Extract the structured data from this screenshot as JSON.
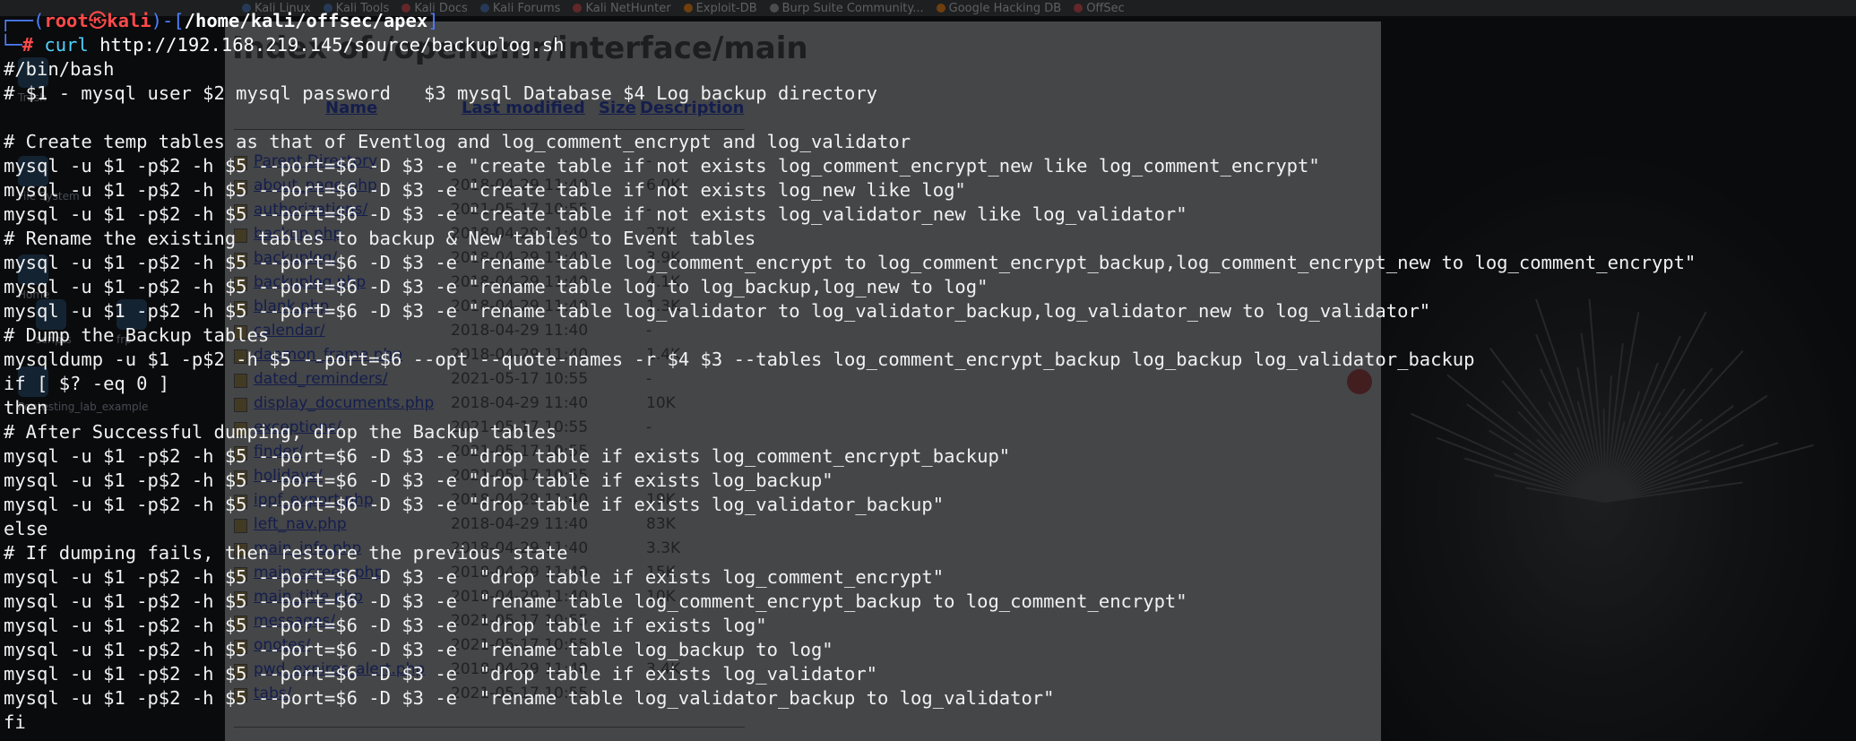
{
  "browser_bookmarks": [
    {
      "label": "Kali Linux",
      "icon": "kali-dragon-icon",
      "color": "#3a5a8a"
    },
    {
      "label": "Kali Tools",
      "icon": "kali-dragon-icon",
      "color": "#3a5a8a"
    },
    {
      "label": "Kali Docs",
      "icon": "kali-docs-icon",
      "color": "#a33a3a"
    },
    {
      "label": "Kali Forums",
      "icon": "kali-dragon-icon",
      "color": "#3a5a8a"
    },
    {
      "label": "Kali NetHunter",
      "icon": "nethunter-icon",
      "color": "#a33a3a"
    },
    {
      "label": "Exploit-DB",
      "icon": "exploitdb-icon",
      "color": "#b8630b"
    },
    {
      "label": "Burp Suite Community...",
      "icon": "globe-icon",
      "color": "#7a7a7a"
    },
    {
      "label": "Google Hacking DB",
      "icon": "ghdb-icon",
      "color": "#b8630b"
    },
    {
      "label": "OffSec",
      "icon": "offsec-icon",
      "color": "#a33a3a"
    }
  ],
  "browser_page": {
    "heading": "Index of /openemr/interface/main",
    "columns": [
      "Name",
      "Last modified",
      "Size",
      "Description"
    ],
    "rows": [
      {
        "name": "Parent Directory",
        "date": "",
        "size": "-"
      },
      {
        "name": "about_page.php",
        "date": "2018-04-29 11:40",
        "size": "6.0K"
      },
      {
        "name": "authorizations/",
        "date": "2021-05-17 10:55",
        "size": "-"
      },
      {
        "name": "backup.php",
        "date": "2018-04-29 11:40",
        "size": "27K"
      },
      {
        "name": "backuplog/",
        "date": "2018-04-29 11:40",
        "size": "3.9K"
      },
      {
        "name": "backuplog.php",
        "date": "2018-04-29 11:40",
        "size": "4.1K"
      },
      {
        "name": "blank.php",
        "date": "2018-04-29 11:40",
        "size": "1.3K"
      },
      {
        "name": "calendar/",
        "date": "2018-04-29 11:40",
        "size": "-"
      },
      {
        "name": "daemon_frame.php",
        "date": "2018-04-29 11:40",
        "size": "1.4K"
      },
      {
        "name": "dated_reminders/",
        "date": "2021-05-17 10:55",
        "size": "-"
      },
      {
        "name": "display_documents.php",
        "date": "2018-04-29 11:40",
        "size": "10K"
      },
      {
        "name": "exceptions/",
        "date": "2021-05-17 10:55",
        "size": "-"
      },
      {
        "name": "finder/",
        "date": "2021-05-17 10:55",
        "size": "-"
      },
      {
        "name": "holidays/",
        "date": "2021-05-17 10:55",
        "size": "-"
      },
      {
        "name": "ippf_export.php",
        "date": "2018-04-29 11:40",
        "size": "19K"
      },
      {
        "name": "left_nav.php",
        "date": "2018-04-29 11:40",
        "size": "83K"
      },
      {
        "name": "main_info.php",
        "date": "2018-04-29 11:40",
        "size": "3.3K"
      },
      {
        "name": "main_screen.php",
        "date": "2018-04-29 11:40",
        "size": "15K"
      },
      {
        "name": "main_title.php",
        "date": "2018-04-29 11:40",
        "size": "10K"
      },
      {
        "name": "messages/",
        "date": "2021-05-17 10:55",
        "size": "-"
      },
      {
        "name": "onotes/",
        "date": "2021-05-17 10:55",
        "size": "-"
      },
      {
        "name": "pwd_expires_alert.php",
        "date": "2018-04-29 11:40",
        "size": "3.4K"
      },
      {
        "name": "tabs/",
        "date": "2021-05-17 10:55",
        "size": "-"
      }
    ]
  },
  "desktop_icons": [
    {
      "label": "Trash",
      "icon": "trash-icon"
    },
    {
      "label": "File System",
      "icon": "filesystem-icon"
    },
    {
      "label": "Home",
      "icon": "home-icon"
    },
    {
      "label": "scripts",
      "icon": "folder-icon"
    },
    {
      "label": "frp",
      "icon": "folder-icon"
    },
    {
      "label": "Pentesting_lab_example",
      "icon": "folder-icon"
    }
  ],
  "terminal": {
    "prompt": {
      "open": "┌──(",
      "user": "root",
      "skull": "㉿",
      "host": "kali",
      "mid": ")-[",
      "path": "/home/kali/offsec/apex",
      "close": "]",
      "line2_prefix": "└─",
      "hash": "#"
    },
    "command": {
      "name": "curl",
      "args": "http://192.168.219.145/source/backuplog.sh"
    },
    "output": [
      "#/bin/bash",
      "# $1 - mysql user $2 mysql password   $3 mysql Database $4 Log backup directory",
      "",
      "# Create temp tables as that of Eventlog and log_comment_encrypt and log_validator",
      "mysql -u $1 -p$2 -h $5 --port=$6 -D $3 -e \"create table if not exists log_comment_encrypt_new like log_comment_encrypt\"",
      "mysql -u $1 -p$2 -h $5 --port=$6 -D $3 -e \"create table if not exists log_new like log\"",
      "mysql -u $1 -p$2 -h $5 --port=$6 -D $3 -e \"create table if not exists log_validator_new like log_validator\"",
      "# Rename the existing  tables to backup & New tables to Event tables",
      "mysql -u $1 -p$2 -h $5 --port=$6 -D $3 -e \"rename table log_comment_encrypt to log_comment_encrypt_backup,log_comment_encrypt_new to log_comment_encrypt\"",
      "mysql -u $1 -p$2 -h $5 --port=$6 -D $3 -e \"rename table log to log_backup,log_new to log\"",
      "mysql -u $1 -p$2 -h $5 --port=$6 -D $3 -e \"rename table log_validator to log_validator_backup,log_validator_new to log_validator\"",
      "# Dump the Backup tables",
      "mysqldump -u $1 -p$2 -h $5 --port=$6 --opt --quote-names -r $4 $3 --tables log_comment_encrypt_backup log_backup log_validator_backup",
      "if [ $? -eq 0 ]",
      "then",
      "# After Successful dumping, drop the Backup tables",
      "mysql -u $1 -p$2 -h $5 --port=$6 -D $3 -e \"drop table if exists log_comment_encrypt_backup\"",
      "mysql -u $1 -p$2 -h $5 --port=$6 -D $3 -e \"drop table if exists log_backup\"",
      "mysql -u $1 -p$2 -h $5 --port=$6 -D $3 -e \"drop table if exists log_validator_backup\"",
      "else",
      "# If dumping fails, then restore the previous state",
      "mysql -u $1 -p$2 -h $5 --port=$6 -D $3 -e  \"drop table if exists log_comment_encrypt\"",
      "mysql -u $1 -p$2 -h $5 --port=$6 -D $3 -e  \"rename table log_comment_encrypt_backup to log_comment_encrypt\"",
      "mysql -u $1 -p$2 -h $5 --port=$6 -D $3 -e  \"drop table if exists log\"",
      "mysql -u $1 -p$2 -h $5 --port=$6 -D $3 -e  \"rename table log_backup to log\"",
      "mysql -u $1 -p$2 -h $5 --port=$6 -D $3 -e  \"drop table if exists log_validator\"",
      "mysql -u $1 -p$2 -h $5 --port=$6 -D $3 -e  \"rename table log_validator_backup to log_validator\"",
      "fi"
    ]
  }
}
